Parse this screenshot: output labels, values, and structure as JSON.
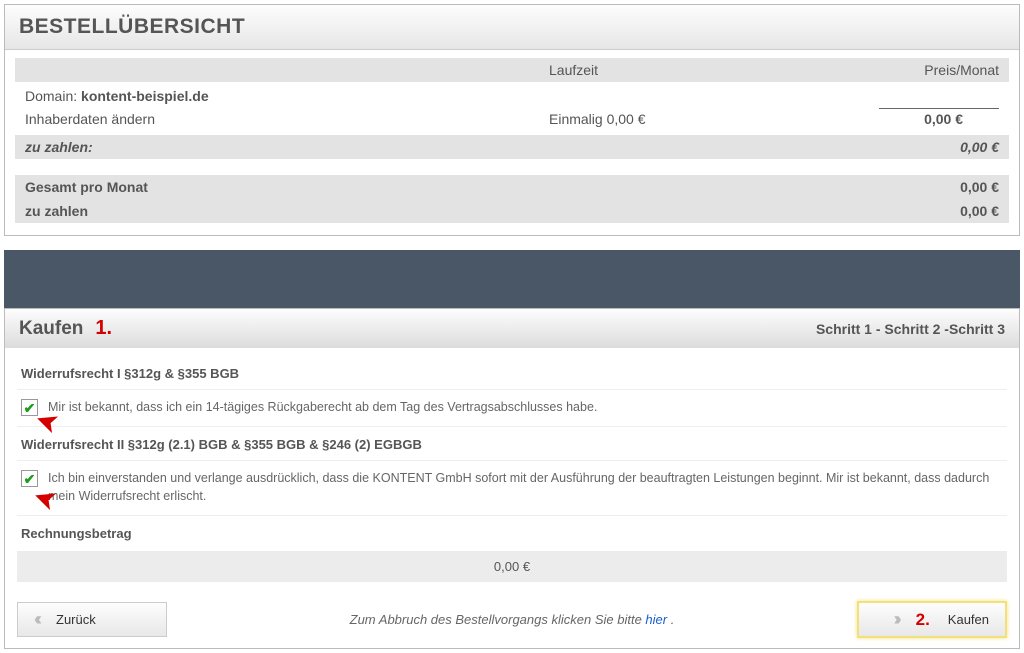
{
  "overview": {
    "title": "BESTELLÜBERSICHT",
    "columns": {
      "laufzeit": "Laufzeit",
      "preis": "Preis/Monat"
    },
    "domain_prefix": "Domain: ",
    "domain": "kontent-beispiel.de",
    "item_label": "Inhaberdaten ändern",
    "item_type": "Einmalig 0,00 €",
    "item_sum": "0,00 €",
    "to_pay_label": "zu zahlen:",
    "to_pay_value": "0,00 €",
    "total_label": "Gesamt pro Monat",
    "total_value": "0,00 €",
    "grand_label": "zu zahlen",
    "grand_value": "0,00 €"
  },
  "buy": {
    "title": "Kaufen",
    "annotation1": "1.",
    "steps": "Schritt 1 - Schritt 2 -Schritt 3",
    "section1_title": "Widerrufsrecht I §312g & §355 BGB",
    "section1_text": "Mir ist bekannt, dass ich ein 14-tägiges Rückgaberecht ab dem Tag des Vertragsabschlusses habe.",
    "section2_title": "Widerrufsrecht II §312g (2.1) BGB & §355 BGB & §246 (2) EGBGB",
    "section2_text": "Ich bin einverstanden und verlange ausdrücklich, dass die KONTENT GmbH sofort mit der Ausführung der beauftragten Leistungen beginnt. Mir ist bekannt, dass dadurch mein Widerrufsrecht erlischt.",
    "amount_label": "Rechnungsbetrag",
    "amount_value": "0,00 €",
    "back_label": "Zurück",
    "cancel_text": "Zum Abbruch des Bestellvorgangs klicken Sie bitte ",
    "cancel_link": "hier",
    "cancel_suffix": " .",
    "annotation2": "2.",
    "buy_label": "Kaufen"
  }
}
